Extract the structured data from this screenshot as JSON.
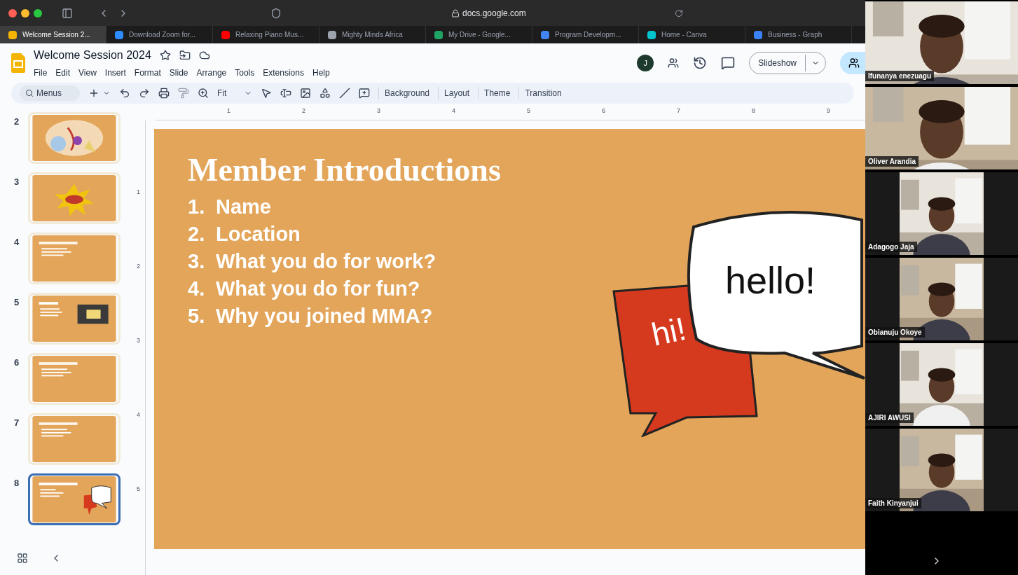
{
  "browser": {
    "address": "docs.google.com",
    "tabs": [
      {
        "title": "Welcome Session 2...",
        "selected": true,
        "color": "#f4b400"
      },
      {
        "title": "Download Zoom for...",
        "selected": false,
        "color": "#2d8cff"
      },
      {
        "title": "Relaxing Piano Mus...",
        "selected": false,
        "color": "#ff0000"
      },
      {
        "title": "Mighty Minds Africa",
        "selected": false,
        "color": "#9ca3af"
      },
      {
        "title": "My Drive - Google...",
        "selected": false,
        "color": "#1fa463"
      },
      {
        "title": "Program Developm...",
        "selected": false,
        "color": "#4285f4"
      },
      {
        "title": "Home - Canva",
        "selected": false,
        "color": "#00c4cc"
      },
      {
        "title": "Business - Graph",
        "selected": false,
        "color": "#3b82f6"
      }
    ]
  },
  "app": {
    "title": "Welcome Session 2024",
    "menu": [
      "File",
      "Edit",
      "View",
      "Insert",
      "Format",
      "Slide",
      "Arrange",
      "Tools",
      "Extensions",
      "Help"
    ],
    "avatar": "J",
    "slideshow_button": "Slideshow"
  },
  "toolbar": {
    "search": "Menus",
    "zoom": "Fit",
    "buttons": [
      "Background",
      "Layout",
      "Theme",
      "Transition"
    ]
  },
  "rulers": {
    "horizontal": [
      "1",
      "2",
      "3",
      "4",
      "5",
      "6",
      "7",
      "8",
      "9"
    ],
    "vertical": [
      "1",
      "2",
      "3",
      "4",
      "5"
    ]
  },
  "thumbnails": [
    {
      "number": "2",
      "kind": "confetti",
      "selected": false
    },
    {
      "number": "3",
      "kind": "burst",
      "selected": false
    },
    {
      "number": "4",
      "kind": "text",
      "selected": false
    },
    {
      "number": "5",
      "kind": "text_photo",
      "selected": false
    },
    {
      "number": "6",
      "kind": "text",
      "selected": false
    },
    {
      "number": "7",
      "kind": "text",
      "selected": false
    },
    {
      "number": "8",
      "kind": "bubbles",
      "selected": true
    }
  ],
  "slide": {
    "title": "Member Introductions",
    "items": [
      {
        "number": "1.",
        "text": "Name"
      },
      {
        "number": "2.",
        "text": "Location"
      },
      {
        "number": "3.",
        "text": "What you do for work?"
      },
      {
        "number": "4.",
        "text": "What you do for fun?"
      },
      {
        "number": "5.",
        "text": "Why you joined MMA?"
      }
    ],
    "bubbles": [
      "hi!",
      "hello!"
    ]
  },
  "participants": [
    {
      "name": "Ifunanya enezuagu",
      "kind": "full"
    },
    {
      "name": "Oliver Arandia",
      "kind": "full"
    },
    {
      "name": "Adagogo Jaja",
      "kind": "pillarbox"
    },
    {
      "name": "Obianuju Okoye",
      "kind": "pillarbox"
    },
    {
      "name": "AJIRI AWUSI",
      "kind": "pillarbox"
    },
    {
      "name": "Faith Kinyanjui",
      "kind": "pillarbox"
    }
  ]
}
